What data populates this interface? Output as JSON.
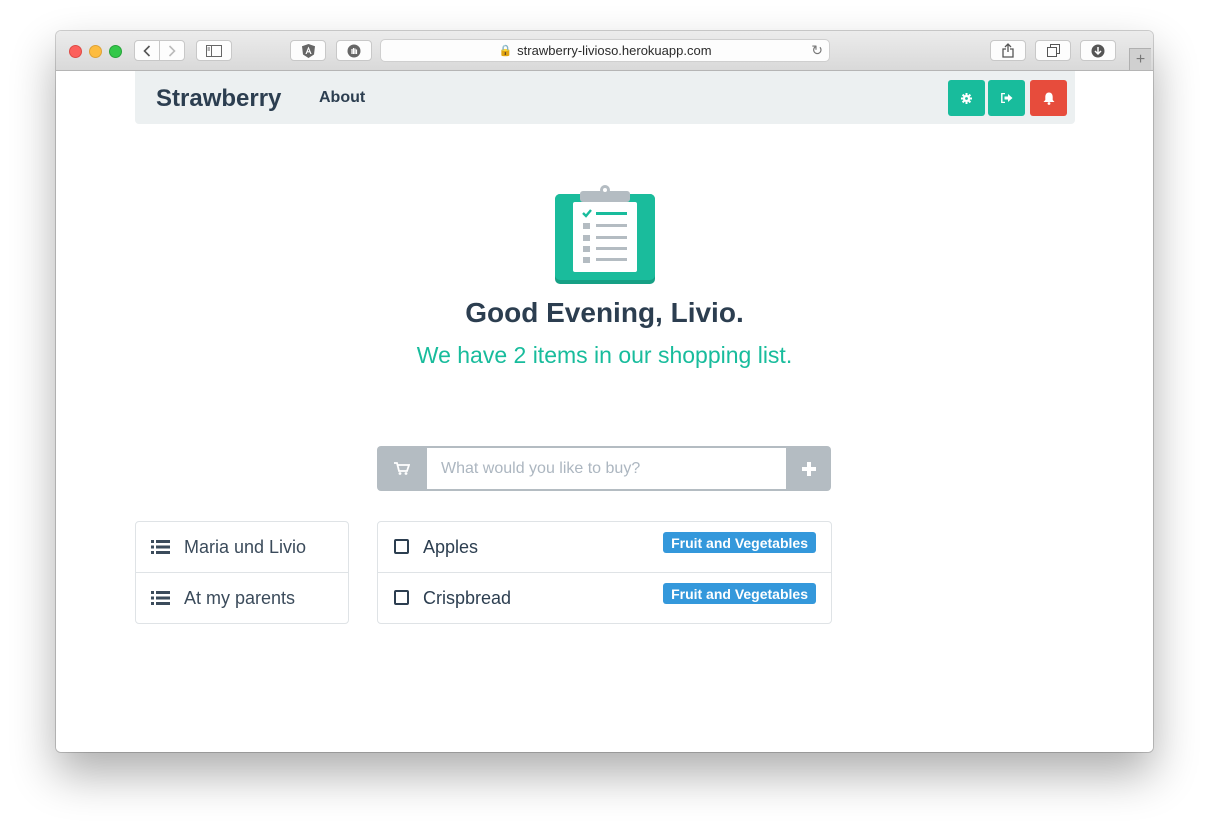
{
  "browser": {
    "url": "strawberry-livioso.herokuapp.com"
  },
  "navbar": {
    "brand": "Strawberry",
    "about": "About",
    "buttons": [
      {
        "icon": "gear-icon",
        "color": "#18bc9c"
      },
      {
        "icon": "sign-out-icon",
        "color": "#18bc9c"
      },
      {
        "icon": "bell-icon",
        "color": "#e74c3c"
      }
    ]
  },
  "hero": {
    "icon": "clipboard-checklist-icon",
    "greeting": "Good Evening, Livio.",
    "subtitle": "We have 2 items in our shopping list."
  },
  "add_item": {
    "placeholder": "What would you like to buy?",
    "value": "",
    "left_icon": "shopping-cart-icon",
    "button_icon": "plus-icon"
  },
  "lists": [
    {
      "label": "Maria und Livio",
      "icon": "list-icon"
    },
    {
      "label": "At my parents",
      "icon": "list-icon"
    }
  ],
  "items": [
    {
      "label": "Apples",
      "category": "Fruit and Vegetables",
      "checked": false
    },
    {
      "label": "Crispbread",
      "category": "Fruit and Vegetables",
      "checked": false
    }
  ],
  "colors": {
    "primary": "#2c3e50",
    "success": "#18bc9c",
    "danger": "#e74c3c",
    "info": "#3498db",
    "navbar_bg": "#ecf0f1"
  }
}
